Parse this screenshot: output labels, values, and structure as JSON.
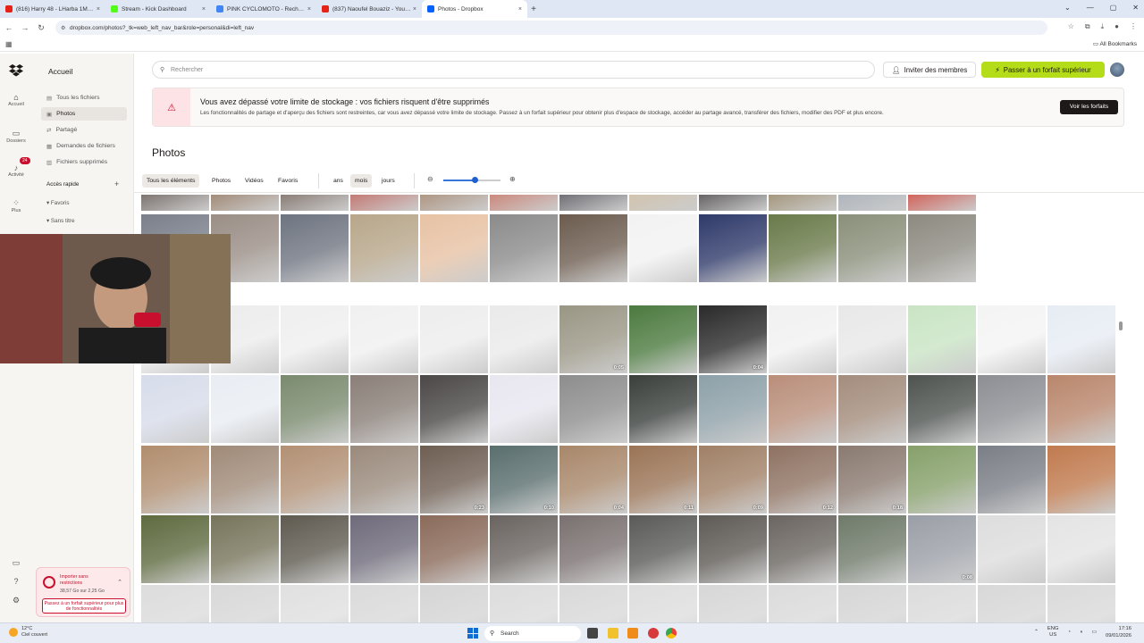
{
  "browser": {
    "tabs": [
      {
        "title": "(816) Harry 48 - LHarba 1Maki...",
        "color": "#e62117",
        "active": false
      },
      {
        "title": "Stream - Kick Dashboard",
        "color": "#53fc18",
        "active": false
      },
      {
        "title": "PINK CYCLOMOTO - Recherche...",
        "color": "#4285f4",
        "active": false
      },
      {
        "title": "(837) Naoufel Bouaziz - YouTu...",
        "color": "#e62117",
        "active": false
      },
      {
        "title": "Photos - Dropbox",
        "color": "#0061fe",
        "active": true
      }
    ],
    "url": "dropbox.com/photos?_tk=web_left_nav_bar&role=personal&di=left_nav",
    "all_bookmarks": "All Bookmarks"
  },
  "rail": {
    "items": [
      {
        "label": "Accueil",
        "icon": "home-icon"
      },
      {
        "label": "Dossiers",
        "icon": "folder-icon"
      },
      {
        "label": "Activité",
        "icon": "bell-icon"
      },
      {
        "label": "Plus",
        "icon": "grid-icon"
      }
    ],
    "badge": "24"
  },
  "sidebar": {
    "home": "Accueil",
    "items": [
      {
        "label": "Tous les fichiers",
        "icon": "files-icon",
        "selected": false
      },
      {
        "label": "Photos",
        "icon": "photos-icon",
        "selected": true
      },
      {
        "label": "Partagé",
        "icon": "shared-icon",
        "selected": false
      },
      {
        "label": "Demandes de fichiers",
        "icon": "request-icon",
        "selected": false
      },
      {
        "label": "Fichiers supprimés",
        "icon": "trash-icon",
        "selected": false
      }
    ],
    "quick_access": "Accès rapide",
    "favorites": "Favoris",
    "untitled": "Sans titre",
    "import": {
      "title": "Importer sans restrictions",
      "usage": "38,57 Go sur 2,25 Go",
      "button": "Passez à un forfait supérieur pour plus de fonctionnalités"
    }
  },
  "header": {
    "search_placeholder": "Rechercher",
    "invite": "Inviter des membres",
    "upgrade": "Passer à un forfait supérieur"
  },
  "banner": {
    "title": "Vous avez dépassé votre limite de stockage : vos fichiers risquent d'être supprimés",
    "text": "Les fonctionnalités de partage et d'aperçu des fichiers sont restreintes, car vous avez dépassé votre limite de stockage. Passez à un forfait supérieur pour obtenir plus d'espace de stockage, accéder au partage avancé, transférer des fichiers, modifier des PDF et plus encore.",
    "button": "Voir les forfaits"
  },
  "page": {
    "title": "Photos"
  },
  "filters": {
    "types": [
      "Tous les éléments",
      "Photos",
      "Vidéos",
      "Favoris"
    ],
    "selected_type": 0,
    "scales": [
      "ans",
      "mois",
      "jours"
    ],
    "selected_scale": 1,
    "zoom_level": 0.55
  },
  "photos": {
    "rows": [
      {
        "colors": [
          "#5a4f4a",
          "#8a6d55",
          "#6b5b52",
          "#b5574f",
          "#9a7a62",
          "#c06a5a",
          "#4a4a52",
          "#c7b59a",
          "#3d3a3a",
          "#8d7c5b",
          "#9aa3ac",
          "#c73a2f"
        ],
        "durations": [
          "",
          "",
          "",
          "",
          "",
          "",
          "",
          "",
          "",
          "",
          "",
          ""
        ]
      },
      {
        "colors": [
          "#7a7f8a",
          "#9a8e86",
          "#6e7480",
          "#b7a68a",
          "#e7c2a4",
          "#8b8b8b",
          "#6c5c4f",
          "#f2f2f2",
          "#2f3a6a",
          "#6a7a4a",
          "#8a8f7a",
          "#8c8a80"
        ],
        "durations": [
          "",
          "",
          "",
          "",
          "",
          "",
          "",
          "",
          "",
          "",
          "",
          ""
        ]
      },
      {
        "colors": [
          "#eeeeee",
          "#ececec",
          "#efefef",
          "#f0f0f0",
          "#ededed",
          "#eaeaea",
          "#9a9685",
          "#4c7a3f",
          "#2a2a2a",
          "#f1f1f1",
          "#e8e8e8",
          "#c9e4c4",
          "#f4f4f4",
          "#e7ecf4"
        ],
        "durations": [
          "",
          "",
          "",
          "",
          "",
          "",
          "0:05",
          "",
          "0:04",
          "",
          "",
          "",
          "",
          ""
        ]
      },
      {
        "colors": [
          "#d7dcea",
          "#e9edf3",
          "#7a8a6e",
          "#8a7f78",
          "#4a4746",
          "#e8e6ef",
          "#8d8d8d",
          "#3a3f3c",
          "#8da0a8",
          "#b98e7a",
          "#a38c7c",
          "#4e5350",
          "#8c8e93",
          "#b9866c"
        ],
        "durations": [
          "",
          "",
          "",
          "",
          "",
          "",
          "",
          "",
          "",
          "",
          "",
          "",
          "",
          ""
        ]
      },
      {
        "colors": [
          "#b08d6e",
          "#a08a78",
          "#b29074",
          "#9a8a7c",
          "#6e5e52",
          "#5a6e6e",
          "#a8876a",
          "#9a7456",
          "#a08066",
          "#8e7262",
          "#8a7a70",
          "#86a06a",
          "#7a7e86",
          "#c07a4e"
        ],
        "durations": [
          "",
          "",
          "",
          "",
          "0:23",
          "0:10",
          "0:04",
          "0:11",
          "0:09",
          "0:12",
          "0:18",
          "",
          "",
          ""
        ]
      },
      {
        "colors": [
          "#5e6a3f",
          "#76745a",
          "#5e5a50",
          "#6e6a7a",
          "#8a6a5a",
          "#6a6460",
          "#7a7070",
          "#5a5a58",
          "#5e5a55",
          "#6a6560",
          "#6f7a6a",
          "#9a9ea6",
          "#dddddd",
          "#e4e4e4"
        ],
        "durations": [
          "",
          "",
          "",
          "",
          "",
          "",
          "",
          "",
          "",
          "",
          "",
          "0:08",
          "",
          ""
        ]
      },
      {
        "colors": [
          "#dcdcdc",
          "#d8d8d8",
          "#e0e0e0",
          "#dadada",
          "#d5d5d5",
          "#dcdcdc",
          "#d9d9d9",
          "#dedede",
          "#d7d7d7",
          "#dbdbdb",
          "#d6d6d6",
          "#dcdcdc",
          "#d8d8d8",
          "#dadada"
        ],
        "durations": [
          "",
          "",
          "",
          "",
          "",
          "",
          "",
          "",
          "",
          "",
          "",
          "",
          "",
          ""
        ]
      }
    ]
  },
  "taskbar": {
    "temperature": "12°C",
    "weather": "Ciel couvert",
    "search": "Search",
    "lang": "ENG",
    "region": "US",
    "time": "17:16",
    "date": "09/01/2026"
  }
}
